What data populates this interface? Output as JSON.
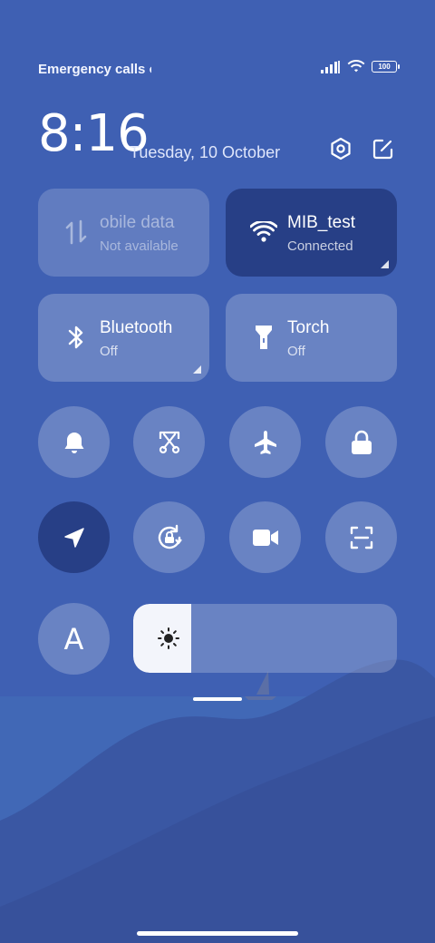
{
  "status_bar": {
    "carrier_text": "Emergency calls o",
    "battery_level": "100",
    "icons": [
      "signal-icon",
      "wifi-icon",
      "battery-icon"
    ]
  },
  "header": {
    "time": "8:16",
    "date": "Tuesday, 10 October",
    "settings_icon": "settings-icon",
    "edit_icon": "edit-icon"
  },
  "tiles": [
    {
      "id": "mobile-data",
      "title": "obile data",
      "subtitle": "Not available",
      "state": "unavailable",
      "icon": "mobile-data-icon"
    },
    {
      "id": "wifi",
      "title": "MIB_test",
      "subtitle": "Connected",
      "state": "on",
      "icon": "wifi-icon"
    },
    {
      "id": "bluetooth",
      "title": "Bluetooth",
      "subtitle": "Off",
      "state": "off",
      "icon": "bluetooth-icon"
    },
    {
      "id": "torch",
      "title": "Torch",
      "subtitle": "Off",
      "state": "off",
      "icon": "torch-icon"
    }
  ],
  "toggles": [
    {
      "id": "ringer",
      "icon": "bell-icon",
      "active": false
    },
    {
      "id": "screenshot",
      "icon": "scissors-icon",
      "active": false
    },
    {
      "id": "airplane-mode",
      "icon": "airplane-icon",
      "active": false
    },
    {
      "id": "lock-screen",
      "icon": "lock-icon",
      "active": false
    },
    {
      "id": "location",
      "icon": "location-arrow-icon",
      "active": true
    },
    {
      "id": "rotation-lock",
      "icon": "rotation-lock-icon",
      "active": false
    },
    {
      "id": "screen-recorder",
      "icon": "video-camera-icon",
      "active": false
    },
    {
      "id": "scanner",
      "icon": "scan-icon",
      "active": false
    },
    {
      "id": "auto-brightness",
      "icon": "font-a-icon",
      "label": "A",
      "active": false
    }
  ],
  "brightness": {
    "level": 0.22,
    "icon": "sun-icon"
  },
  "colors": {
    "background": "#3f60b3",
    "active_tile": "#273f86",
    "tile": "rgba(255,255,255,0.22)"
  }
}
